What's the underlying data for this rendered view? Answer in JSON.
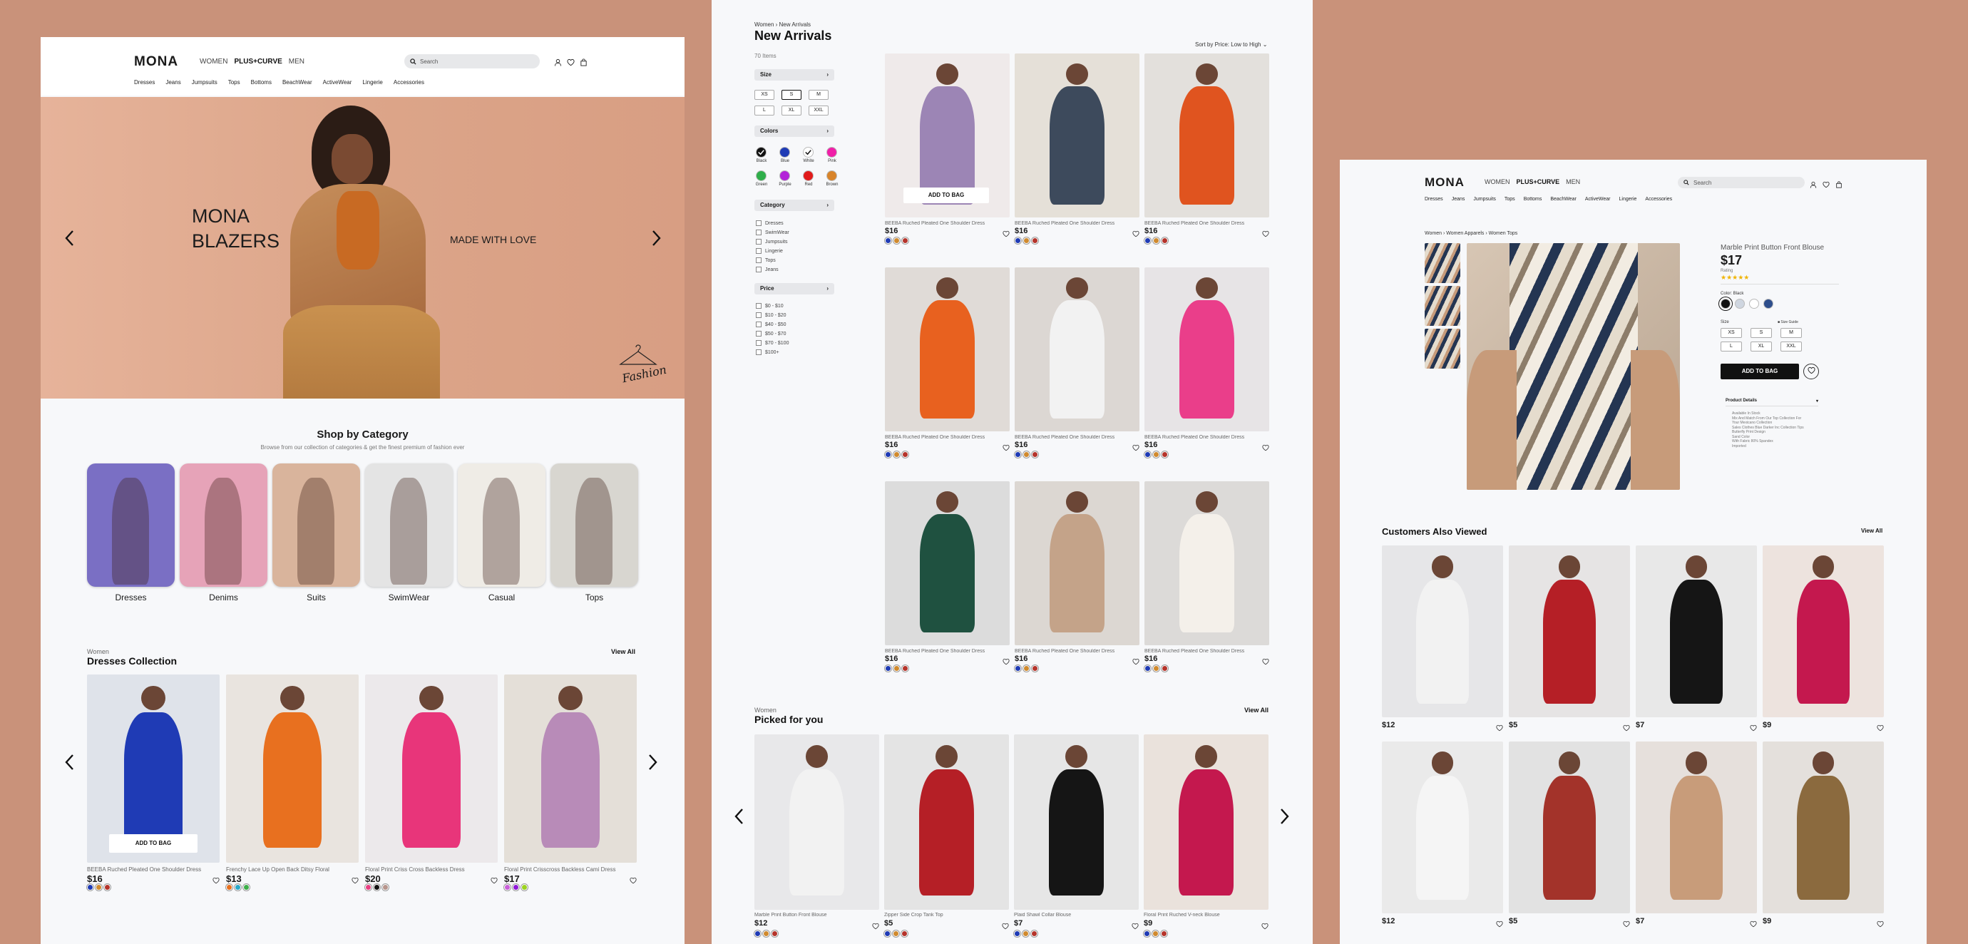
{
  "brand": "MONA",
  "nav": [
    "WOMEN",
    "PLUS+CURVE",
    "MEN"
  ],
  "subnav": [
    "Dresses",
    "Jeans",
    "Jumpsuits",
    "Tops",
    "Bottoms",
    "BeachWear",
    "ActiveWear",
    "Lingerie",
    "Accessories"
  ],
  "search_placeholder": "Search",
  "home": {
    "hero": {
      "title_line1": "MONA",
      "title_line2": "BLAZERS",
      "tagline": "MADE WITH LOVE",
      "signature": "Fashion"
    },
    "category_section": {
      "title": "Shop by Category",
      "subtitle": "Browse from our collection of categories & get the finest premium of fashion ever",
      "items": [
        {
          "label": "Dresses",
          "bg": "#7a6fc4"
        },
        {
          "label": "Denims",
          "bg": "#e6a3b8"
        },
        {
          "label": "Suits",
          "bg": "#d9b49c"
        },
        {
          "label": "SwimWear",
          "bg": "#e4e4e4"
        },
        {
          "label": "Casual",
          "bg": "#efece6"
        },
        {
          "label": "Tops",
          "bg": "#d8d6d0"
        }
      ]
    },
    "collection": {
      "kicker": "Women",
      "title": "Dresses Collection",
      "view_all": "View All",
      "add_to_bag": "ADD TO BAG",
      "products": [
        {
          "name": "BEEBA Ruched Pleated One Shoulder Dress",
          "price": "$16",
          "colors": [
            "#1f3bb5",
            "#d08a2e",
            "#b5342b"
          ]
        },
        {
          "name": "Frenchy Lace Up Open Back Ditsy Floral",
          "price": "$13",
          "colors": [
            "#e8701f",
            "#2aa8c9",
            "#3dae49"
          ]
        },
        {
          "name": "Floral Print Criss Cross Backless Dress",
          "price": "$20",
          "colors": [
            "#e83f82",
            "#111111",
            "#b7958c"
          ]
        },
        {
          "name": "Floral Print Crisscross Backless Cami Dress",
          "price": "$17",
          "colors": [
            "#c85fd8",
            "#8f19d8",
            "#9bd21f"
          ]
        }
      ]
    }
  },
  "listing": {
    "breadcrumb": [
      "Women",
      "New Arrivals"
    ],
    "title": "New Arrivals",
    "count": "70 Items",
    "sort": "Sort by Price: Low to High",
    "filters": {
      "size_label": "Size",
      "sizes": [
        "XS",
        "S",
        "M",
        "L",
        "XL",
        "XXL"
      ],
      "colors_label": "Colors",
      "colors": [
        {
          "name": "Black",
          "hex": "#111111"
        },
        {
          "name": "Blue",
          "hex": "#1f3bb5"
        },
        {
          "name": "White",
          "hex": "#ffffff"
        },
        {
          "name": "Pink",
          "hex": "#f01fa8"
        },
        {
          "name": "Green",
          "hex": "#2fae4a"
        },
        {
          "name": "Purple",
          "hex": "#b324d8"
        },
        {
          "name": "Red",
          "hex": "#e11b1b"
        },
        {
          "name": "Brown",
          "hex": "#d8842a"
        }
      ],
      "category_label": "Category",
      "categories": [
        "Dresses",
        "SwimWear",
        "Jumpsuits",
        "Lingerie",
        "Tops",
        "Jeans"
      ],
      "price_label": "Price",
      "prices": [
        "$0 - $10",
        "$10 - $20",
        "$40 - $50",
        "$50 - $70",
        "$70 - $100",
        "$100+"
      ]
    },
    "product_name": "BEEBA Ruched Pleated One Shoulder Dress",
    "product_price": "$16",
    "product_colors": [
      "#1f3bb5",
      "#d08a2e",
      "#b5342b"
    ],
    "add_to_bag": "ADD TO BAG",
    "grid_colors": [
      "#9c85b5",
      "#3d4a5c",
      "#e0541f",
      "#e8611f",
      "#f2f2f2",
      "#ea3e8a",
      "#1f5140",
      "#c4a389",
      "#f4f0ea"
    ],
    "picked": {
      "kicker": "Women",
      "title": "Picked for you",
      "view_all": "View All",
      "products": [
        {
          "name": "Marble Print Button Front Blouse",
          "price": "$12",
          "colors": [
            "#1f3bb5",
            "#d08a2e",
            "#b5342b"
          ]
        },
        {
          "name": "Zipper Side Crop Tank Top",
          "price": "$5",
          "colors": [
            "#1f3bb5",
            "#d08a2e",
            "#b5342b"
          ]
        },
        {
          "name": "Plaid Shawl Collar Blouse",
          "price": "$7",
          "colors": [
            "#1f3bb5",
            "#d08a2e",
            "#b5342b"
          ]
        },
        {
          "name": "Floral Print Ruched V-neck Blouse",
          "price": "$9",
          "colors": [
            "#1f3bb5",
            "#d08a2e",
            "#b5342b"
          ]
        }
      ]
    }
  },
  "detail": {
    "breadcrumb": [
      "Women",
      "Women Apparels",
      "Women Tops"
    ],
    "product_title": "Marble Print Button Front Blouse",
    "price": "$17",
    "rating_label": "Rating",
    "stars": "★★★★★",
    "color_label": "Color: Black",
    "colors": [
      "#111111",
      "#cfd6e0",
      "#ffffff",
      "#2e4e8c"
    ],
    "size_label": "Size",
    "size_guide": "Size Guide",
    "sizes": [
      "XS",
      "S",
      "M",
      "L",
      "XL",
      "XXL"
    ],
    "add_to_bag": "ADD TO BAG",
    "details_label": "Product Details",
    "details_lines": [
      "Available In Stock",
      "Mix And Match From Our Top Collection For",
      "Your Mexicano Collection",
      "Sales Clothes Blue Darker Inc Collection Tips",
      "Butterfly Print Design",
      "Sand Color",
      "With Fabric 80% Spandex",
      "Imported"
    ],
    "also_viewed": {
      "title": "Customers Also Viewed",
      "view_all": "View All",
      "products": [
        {
          "price": "$12"
        },
        {
          "price": "$5"
        },
        {
          "price": "$7"
        },
        {
          "price": "$9"
        },
        {
          "price": "$12"
        },
        {
          "price": "$5"
        },
        {
          "price": "$7"
        },
        {
          "price": "$9"
        }
      ]
    }
  }
}
